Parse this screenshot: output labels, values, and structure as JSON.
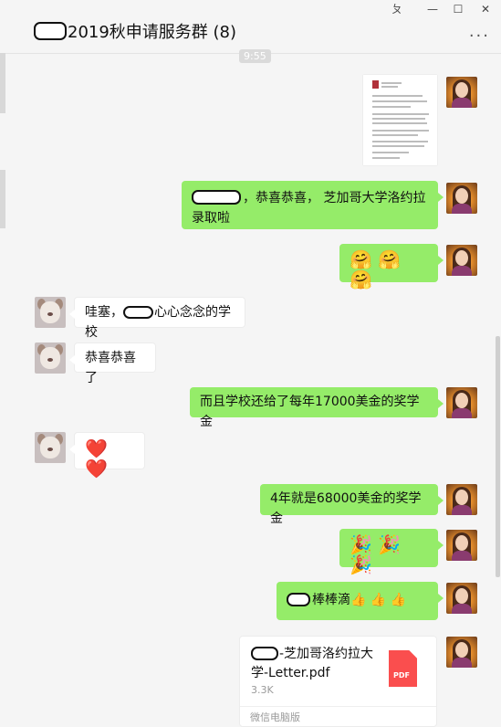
{
  "window": {
    "title": "2019秋申请服务群 (8)",
    "pin_label": "ㄆ",
    "minimize_label": "—",
    "maximize_label": "☐",
    "close_label": "✕",
    "more_label": "..."
  },
  "timestamp": "9:55",
  "messages": {
    "m1": {
      "sender": "me",
      "type": "image",
      "description": "document-letter-image"
    },
    "m2": {
      "sender": "me",
      "text": "，恭喜恭喜， 芝加哥大学洛约拉",
      "text_line2": "录取啦"
    },
    "m3": {
      "sender": "me",
      "text": "🤗 🤗 🤗"
    },
    "m4": {
      "sender": "other",
      "text_prefix": "哇塞，",
      "text_suffix": "心心念念的学校"
    },
    "m5": {
      "sender": "other",
      "text": "恭喜恭喜了"
    },
    "m6": {
      "sender": "me",
      "text": "而且学校还给了每年17000美金的奖学金"
    },
    "m7": {
      "sender": "other",
      "text": "❤️ ❤️"
    },
    "m8": {
      "sender": "me",
      "text": "4年就是68000美金的奖学金"
    },
    "m9": {
      "sender": "me",
      "text": "🎉 🎉 🎉"
    },
    "m10": {
      "sender": "me",
      "text": "棒棒滴👍 👍 👍"
    },
    "m11": {
      "sender": "me",
      "type": "file",
      "file_name_line1": "-芝加哥洛约拉大",
      "file_name_line2": "学-Letter.pdf",
      "file_size": "3.3K",
      "file_badge": "PDF",
      "source": "微信电脑版"
    }
  },
  "icons": {
    "pin": "pin-icon",
    "minimize": "minimize-icon",
    "maximize": "maximize-icon",
    "close": "close-icon",
    "more": "more-icon",
    "pdf": "pdf-file-icon"
  },
  "colors": {
    "my_bubble": "#95ec69",
    "other_bubble": "#ffffff",
    "background": "#f5f5f5",
    "pdf_red": "#fa4e4e"
  }
}
